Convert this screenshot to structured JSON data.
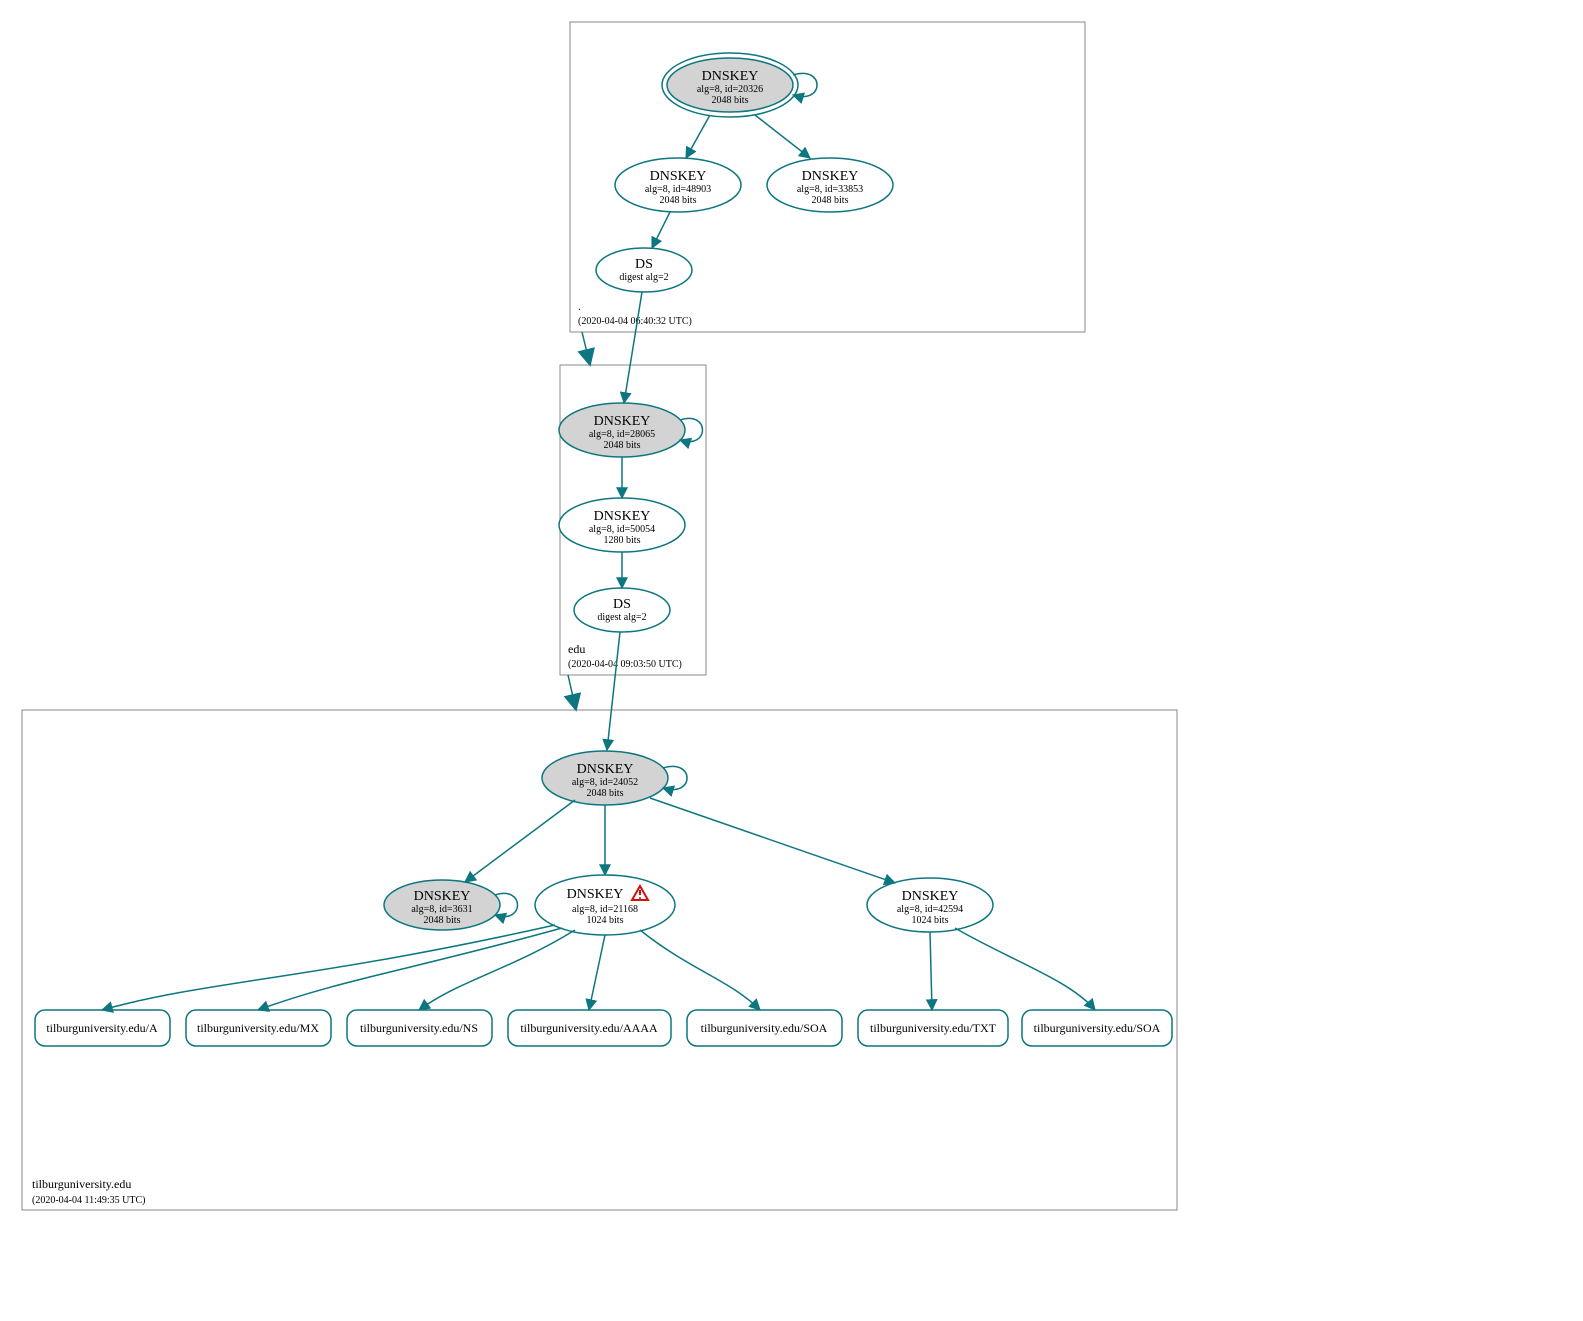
{
  "zones": {
    "root": {
      "label": ".",
      "timestamp": "(2020-04-04 06:40:32 UTC)",
      "nodes": {
        "dnskey_20326": {
          "title": "DNSKEY",
          "line1": "alg=8, id=20326",
          "line2": "2048 bits"
        },
        "dnskey_48903": {
          "title": "DNSKEY",
          "line1": "alg=8, id=48903",
          "line2": "2048 bits"
        },
        "dnskey_33853": {
          "title": "DNSKEY",
          "line1": "alg=8, id=33853",
          "line2": "2048 bits"
        },
        "ds_root": {
          "title": "DS",
          "line1": "digest alg=2"
        }
      }
    },
    "edu": {
      "label": "edu",
      "timestamp": "(2020-04-04 09:03:50 UTC)",
      "nodes": {
        "dnskey_28065": {
          "title": "DNSKEY",
          "line1": "alg=8, id=28065",
          "line2": "2048 bits"
        },
        "dnskey_50054": {
          "title": "DNSKEY",
          "line1": "alg=8, id=50054",
          "line2": "1280 bits"
        },
        "ds_edu": {
          "title": "DS",
          "line1": "digest alg=2"
        }
      }
    },
    "tilburg": {
      "label": "tilburguniversity.edu",
      "timestamp": "(2020-04-04 11:49:35 UTC)",
      "nodes": {
        "dnskey_24052": {
          "title": "DNSKEY",
          "line1": "alg=8, id=24052",
          "line2": "2048 bits"
        },
        "dnskey_3631": {
          "title": "DNSKEY",
          "line1": "alg=8, id=3631",
          "line2": "2048 bits"
        },
        "dnskey_21168": {
          "title": "DNSKEY",
          "line1": "alg=8, id=21168",
          "line2": "1024 bits"
        },
        "dnskey_42594": {
          "title": "DNSKEY",
          "line1": "alg=8, id=42594",
          "line2": "1024 bits"
        }
      },
      "records": {
        "a": "tilburguniversity.edu/A",
        "mx": "tilburguniversity.edu/MX",
        "ns": "tilburguniversity.edu/NS",
        "aaaa": "tilburguniversity.edu/AAAA",
        "soa1": "tilburguniversity.edu/SOA",
        "txt": "tilburguniversity.edu/TXT",
        "soa2": "tilburguniversity.edu/SOA"
      }
    }
  }
}
